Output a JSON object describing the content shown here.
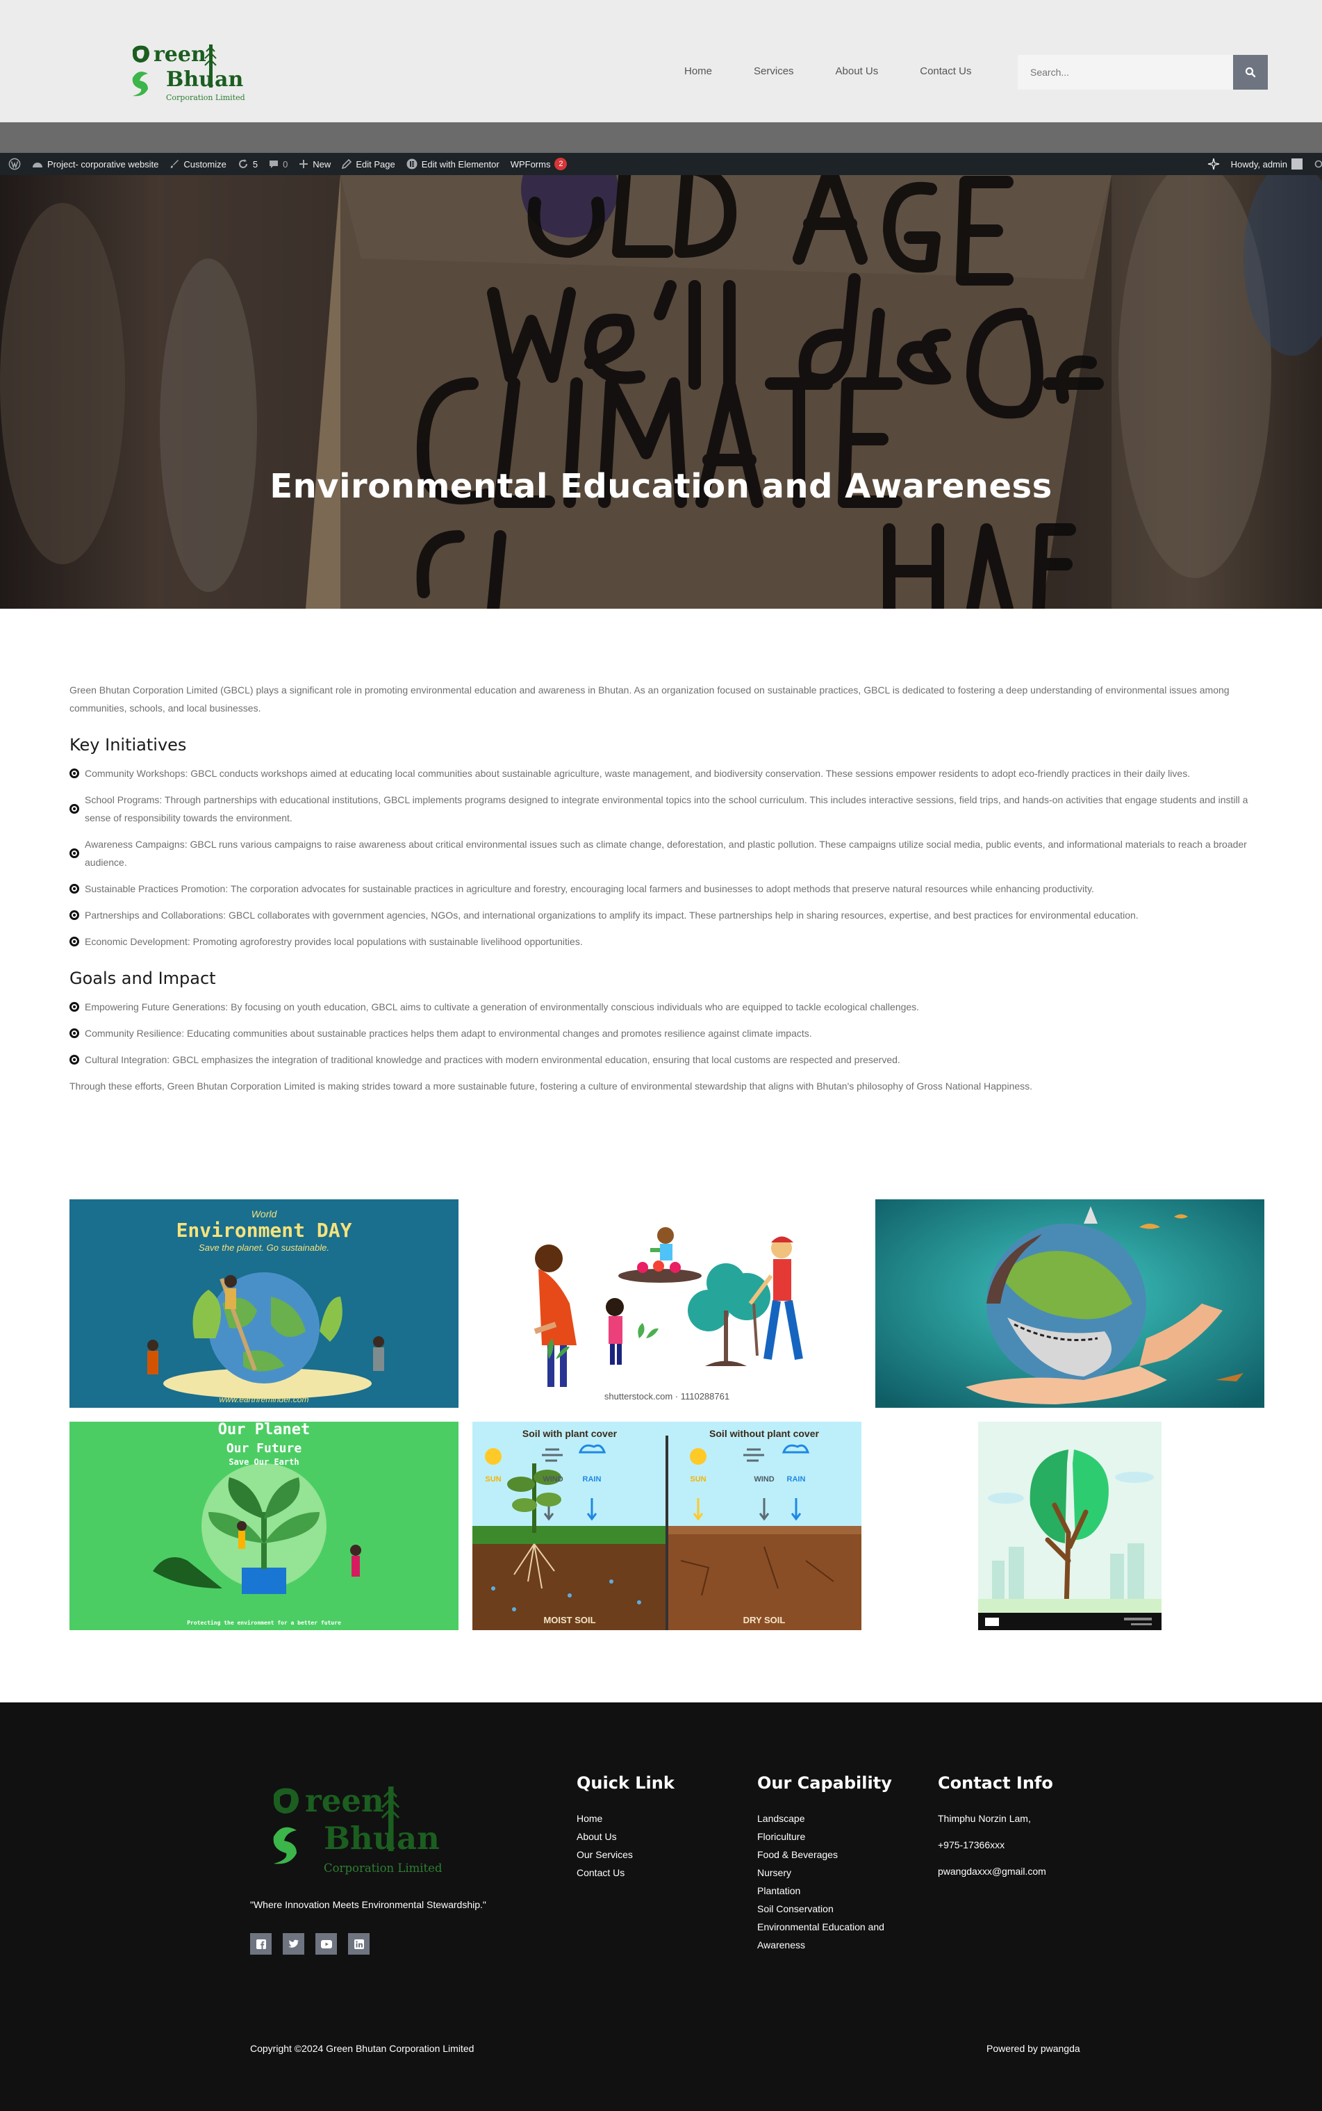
{
  "header": {
    "logo": {
      "line1": "reen",
      "line2": "Bhu",
      "line2b": "an",
      "sub": "Corporation Limited"
    },
    "nav": [
      "Home",
      "Services",
      "About Us",
      "Contact Us"
    ],
    "search_placeholder": "Search..."
  },
  "adminbar": {
    "site_name": "Project- corporative website",
    "customize": "Customize",
    "updates": "5",
    "comments": "0",
    "new": "New",
    "edit_page": "Edit Page",
    "elementor": "Edit with Elementor",
    "wpforms": "WPForms",
    "wpforms_badge": "2",
    "howdy": "Howdy, admin"
  },
  "hero": {
    "title": "Environmental Education and Awareness",
    "sign_line1": "OLD AGE",
    "sign_line2": "We'll die",
    "sign_line3": "Of",
    "sign_line4": "CLIMATE CHANGE"
  },
  "content": {
    "intro": "Green Bhutan Corporation Limited (GBCL) plays a significant role in promoting environmental education and awareness in Bhutan. As an organization focused on sustainable practices, GBCL is dedicated to fostering a deep understanding of environmental issues among communities, schools, and local businesses.",
    "initiatives_heading": "Key Initiatives",
    "initiatives": [
      "Community Workshops: GBCL conducts workshops aimed at educating local communities about sustainable agriculture, waste management, and biodiversity conservation. These sessions empower residents to adopt eco-friendly practices in their daily lives.",
      "School Programs: Through partnerships with educational institutions, GBCL implements programs designed to integrate environmental topics into the school curriculum. This includes interactive sessions, field trips, and hands-on activities that engage students and instill a sense of responsibility towards the environment.",
      "Awareness Campaigns: GBCL runs various campaigns to raise awareness about critical environmental issues such as climate change, deforestation, and plastic pollution. These campaigns utilize social media, public events, and informational materials to reach a broader audience.",
      "Sustainable Practices Promotion: The corporation advocates for sustainable practices in agriculture and forestry, encouraging local farmers and businesses to adopt methods that preserve natural resources while enhancing productivity.",
      "Partnerships and Collaborations: GBCL collaborates with government agencies, NGOs, and international organizations to amplify its impact. These partnerships help in sharing resources, expertise, and best practices for environmental education.",
      "Economic Development: Promoting agroforestry provides local populations with sustainable livelihood opportunities."
    ],
    "goals_heading": "Goals and Impact",
    "goals": [
      "Empowering Future Generations: By focusing on youth education, GBCL aims to cultivate a generation of environmentally conscious individuals who are equipped to tackle ecological challenges.",
      "Community Resilience: Educating communities about sustainable practices helps them adapt to environmental changes and promotes resilience against climate impacts.",
      "Cultural Integration: GBCL emphasizes the integration of traditional knowledge and practices with modern environmental education, ensuring that local customs are respected and preserved."
    ],
    "closing": "Through these efforts, Green Bhutan Corporation Limited is making strides toward a more sustainable future, fostering a culture of environmental stewardship that aligns with Bhutan's philosophy of Gross National Happiness."
  },
  "gallery": {
    "env_day": {
      "small": "World",
      "title": "Environment DAY",
      "tagline": "Save the planet. Go sustainable.",
      "url": "www.earthreminder.com"
    },
    "kids": {
      "credit": "shutterstock.com · 1110288761"
    },
    "planet": {
      "line1": "Our Planet",
      "line2": "Our Future",
      "line3": "Save Our Earth",
      "footer": "Protecting the environment for a better future"
    },
    "soil": {
      "left_title": "Soil with plant cover",
      "right_title": "Soil without plant cover",
      "sun": "SUN",
      "wind": "WIND",
      "rain": "RAIN",
      "left_label": "MOIST SOIL",
      "right_label": "DRY SOIL"
    }
  },
  "footer": {
    "tagline": "\"Where Innovation Meets Environmental Stewardship.\"",
    "quick_heading": "Quick Link",
    "quick_links": [
      "Home",
      "About Us",
      "Our Services",
      "Contact Us"
    ],
    "capability_heading": "Our Capability",
    "capabilities": [
      "Landscape",
      "Floriculture",
      "Food & Beverages",
      "Nursery",
      "Plantation",
      "Soil Conservation",
      "Environmental Education and",
      "Awareness"
    ],
    "contact_heading": "Contact Info",
    "contact": [
      "Thimphu Norzin Lam,",
      "+975-17366xxx",
      "pwangdaxxx@gmail.com"
    ],
    "copyright": "Copyright ©2024 Green Bhutan Corporation Limited",
    "powered": "Powered by pwangda"
  },
  "colors": {
    "brand_green": "#2e7d32",
    "leaf_green": "#3cb54a",
    "footer_bg": "#111111",
    "adminbar_bg": "#1d2327",
    "button_gray": "#6e7480"
  }
}
